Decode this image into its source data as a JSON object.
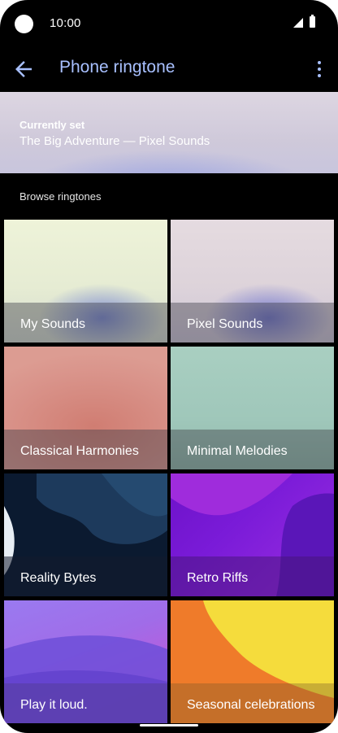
{
  "status_bar": {
    "time": "10:00",
    "icons": [
      "camera-cutout",
      "signal-icon",
      "battery-icon"
    ]
  },
  "app_bar": {
    "title": "Phone ringtone",
    "back_icon": "arrow-back-icon",
    "menu_icon": "more-vert-icon",
    "accent": "#a8c0ff"
  },
  "current": {
    "label": "Currently set",
    "value": "The Big Adventure — Pixel Sounds"
  },
  "browse_label": "Browse ringtones",
  "categories": [
    {
      "name": "My Sounds"
    },
    {
      "name": "Pixel Sounds"
    },
    {
      "name": "Classical Harmonies"
    },
    {
      "name": "Minimal Melodies"
    },
    {
      "name": "Reality Bytes"
    },
    {
      "name": "Retro Riffs"
    },
    {
      "name": "Play it loud."
    },
    {
      "name": "Seasonal celebrations"
    }
  ]
}
